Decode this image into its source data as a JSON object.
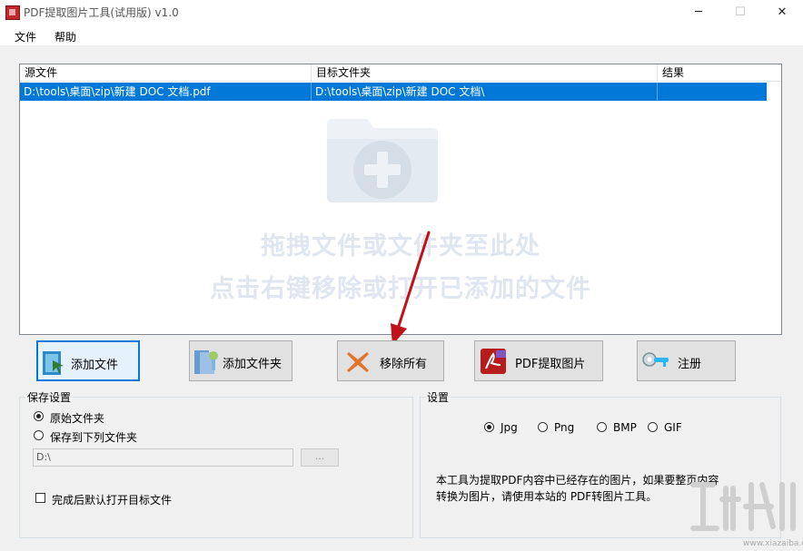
{
  "window": {
    "title": "PDF提取图片工具(试用版) v1.0",
    "minimize_glyph": "─",
    "maximize_glyph": "☐",
    "close_glyph": "✕"
  },
  "menu": {
    "items": [
      "文件",
      "帮助"
    ]
  },
  "file_list": {
    "columns": [
      "源文件",
      "目标文件夹",
      "结果"
    ],
    "rows": [
      {
        "source": "D:\\tools\\桌面\\zip\\新建 DOC 文档.pdf",
        "target": "D:\\tools\\桌面\\zip\\新建 DOC 文档\\",
        "result": "",
        "selected": true
      }
    ],
    "drop_hint_line1": "拖拽文件或文件夹至此处",
    "drop_hint_line2": "点击右键移除或打开已添加的文件"
  },
  "toolbar": {
    "add_file": "添加文件",
    "add_folder": "添加文件夹",
    "remove_all": "移除所有",
    "extract": "PDF提取图片",
    "register": "注册"
  },
  "save_settings": {
    "title": "保存设置",
    "option_original": "原始文件夹",
    "option_custom": "保存到下列文件夹",
    "selected": "原始文件夹",
    "path_value": "D:\\",
    "browse_label": "...",
    "open_after_label": "完成后默认打开目标文件",
    "open_after_checked": false
  },
  "settings": {
    "title": "设置",
    "formats": [
      "Jpg",
      "Png",
      "BMP",
      "GIF"
    ],
    "selected_format": "Jpg",
    "info_line1": "本工具为提取PDF内容中已经存在的图片，如果要整页内容",
    "info_line2": "转换为图片，请使用本站的 PDF转图片工具。"
  },
  "watermark": {
    "url": "www.xiazaiba.com"
  },
  "colors": {
    "selection": "#0078d7",
    "accent_arrow": "#c0121a",
    "hint": "#dfe6ef"
  }
}
